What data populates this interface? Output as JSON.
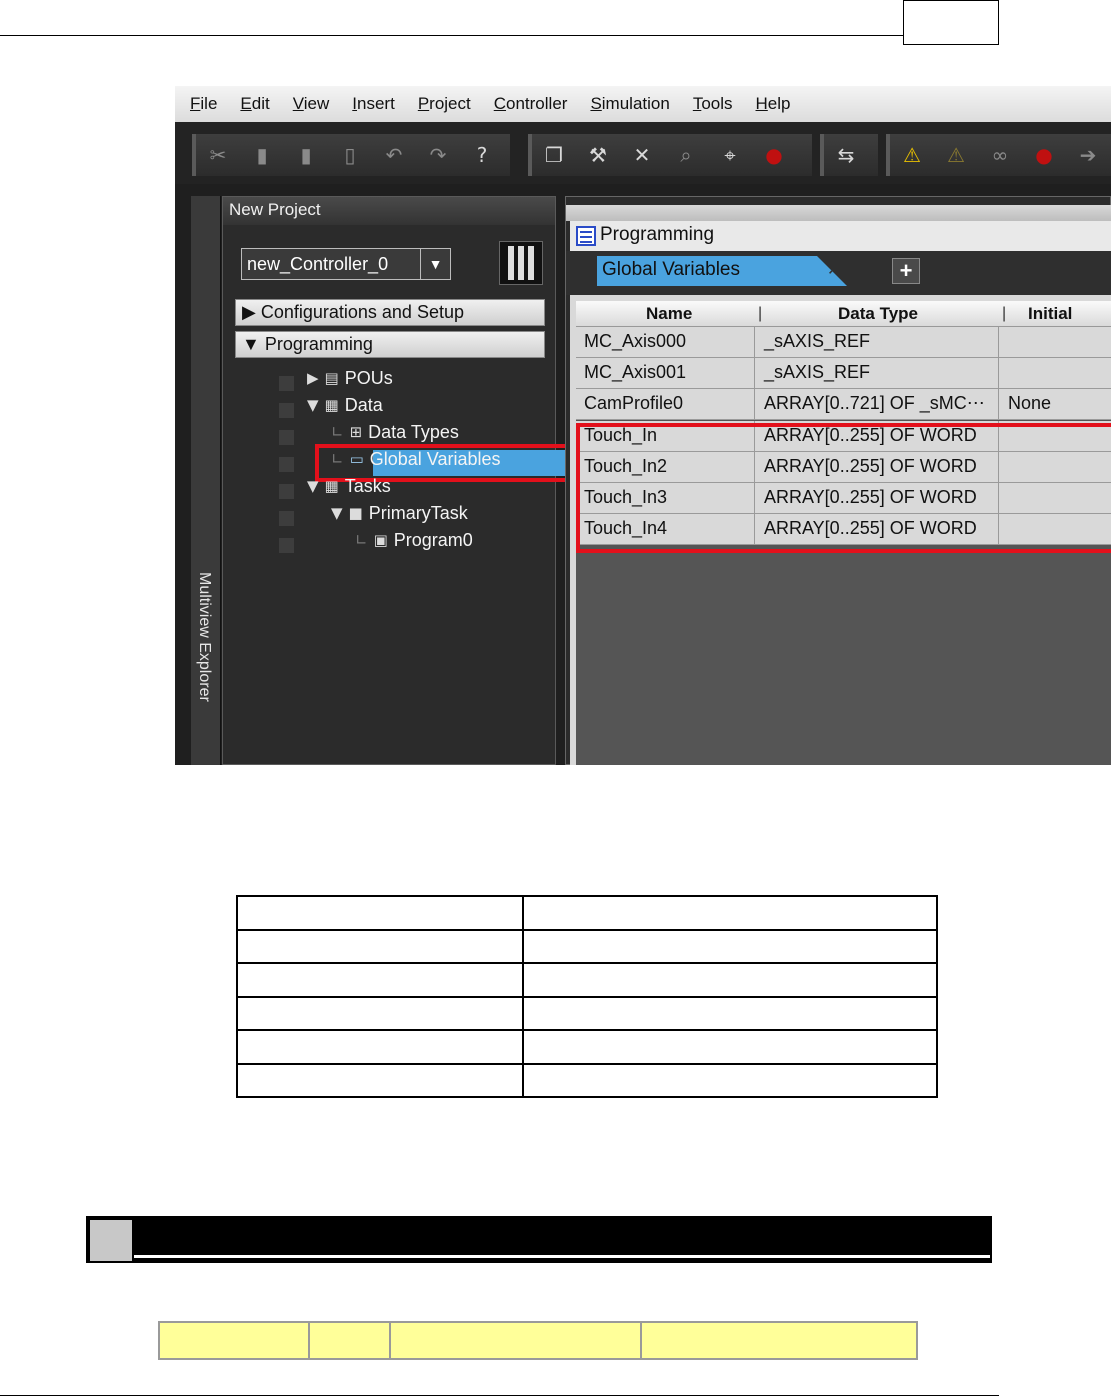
{
  "menu": [
    {
      "label": "File",
      "key": "F",
      "rest": "ile"
    },
    {
      "label": "Edit",
      "key": "E",
      "rest": "dit"
    },
    {
      "label": "View",
      "key": "V",
      "rest": "iew"
    },
    {
      "label": "Insert",
      "key": "I",
      "rest": "nsert"
    },
    {
      "label": "Project",
      "key": "P",
      "rest": "roject"
    },
    {
      "label": "Controller",
      "key": "C",
      "rest": "ontroller"
    },
    {
      "label": "Simulation",
      "key": "S",
      "rest": "imulation"
    },
    {
      "label": "Tools",
      "key": "T",
      "rest": "ools"
    },
    {
      "label": "Help",
      "key": "H",
      "rest": "elp"
    }
  ],
  "toolbar": {
    "icons": [
      "cut-icon",
      "copy-icon",
      "paste-icon",
      "delete-icon",
      "undo-icon",
      "redo-icon",
      "help-icon",
      "window-icon",
      "build-icon",
      "tools-icon",
      "glasses-icon",
      "find-icon",
      "error-icon",
      "transfer-icon",
      "warning-icon",
      "disabled-warning-icon",
      "watch-icon",
      "breakpoint-icon",
      "step-icon"
    ]
  },
  "side_tab": {
    "label": "Multiview Explorer"
  },
  "explorer": {
    "title": "New Project",
    "controller": "new_Controller_0",
    "sections": {
      "config": "Configurations and Setup",
      "programming": "Programming"
    },
    "tree": {
      "pous": "POUs",
      "data": "Data",
      "data_types": "Data Types",
      "global_variables": "Global Variables",
      "tasks": "Tasks",
      "primary_task": "PrimaryTask",
      "program0": "Program0"
    }
  },
  "editor": {
    "title": "Programming",
    "tab_label": "Global Variables",
    "columns": {
      "name": "Name",
      "data_type": "Data Type",
      "initial_value": "Initial Valu"
    },
    "rows": [
      {
        "name": "MC_Axis000",
        "data_type": "_sAXIS_REF",
        "initial_value": ""
      },
      {
        "name": "MC_Axis001",
        "data_type": "_sAXIS_REF",
        "initial_value": ""
      },
      {
        "name": "CamProfile0",
        "data_type": "ARRAY[0..721] OF _sMC⋯",
        "initial_value": "None"
      },
      {
        "name": "Touch_In",
        "data_type": "ARRAY[0..255] OF WORD",
        "initial_value": ""
      },
      {
        "name": "Touch_In2",
        "data_type": "ARRAY[0..255] OF WORD",
        "initial_value": ""
      },
      {
        "name": "Touch_In3",
        "data_type": "ARRAY[0..255] OF WORD",
        "initial_value": ""
      },
      {
        "name": "Touch_In4",
        "data_type": "ARRAY[0..255] OF WORD",
        "initial_value": ""
      }
    ]
  },
  "colors": {
    "selection": "#4aa3df",
    "highlight": "#e3101b",
    "yellow_cell": "#ffff99"
  }
}
